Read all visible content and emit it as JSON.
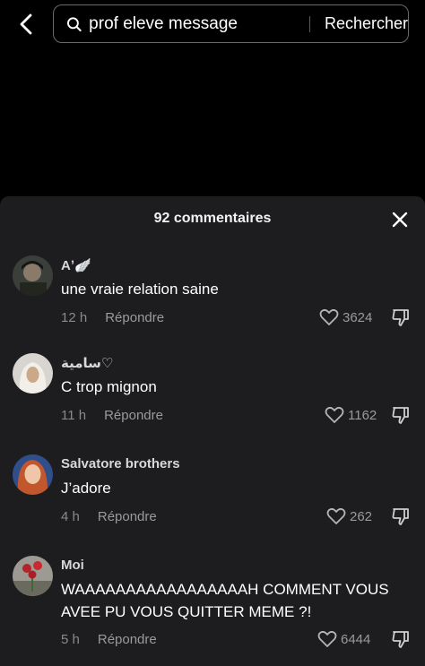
{
  "search": {
    "query": "prof eleve message",
    "submit_label": "Rechercher"
  },
  "comments_panel": {
    "title": "92 commentaires",
    "comments": [
      {
        "username": "Aʼ🪽",
        "text": "une vraie relation saine",
        "time": "12 h",
        "reply_label": "Répondre",
        "likes": "3624",
        "avatar_icon": "avatar-dark-portrait"
      },
      {
        "username": "سامية♡",
        "text": "C trop mignon",
        "time": "11 h",
        "reply_label": "Répondre",
        "likes": "1162",
        "avatar_icon": "avatar-hijab-portrait"
      },
      {
        "username": "Salvatore brothers",
        "text": "J’adore",
        "time": "4 h",
        "reply_label": "Répondre",
        "likes": "262",
        "avatar_icon": "avatar-red-hair-portrait"
      },
      {
        "username": "Moi",
        "text": "WAAAAAAAAAAAAAAAAAH COMMENT VOUS AVEE PU VOUS QUITTER MEME ?!",
        "time": "5 h",
        "reply_label": "Répondre",
        "likes": "6444",
        "avatar_icon": "avatar-roses-photo"
      }
    ]
  },
  "colors": {
    "background": "#000000",
    "sheet": "#1d1d1f",
    "muted_text": "#8a8a8a"
  }
}
